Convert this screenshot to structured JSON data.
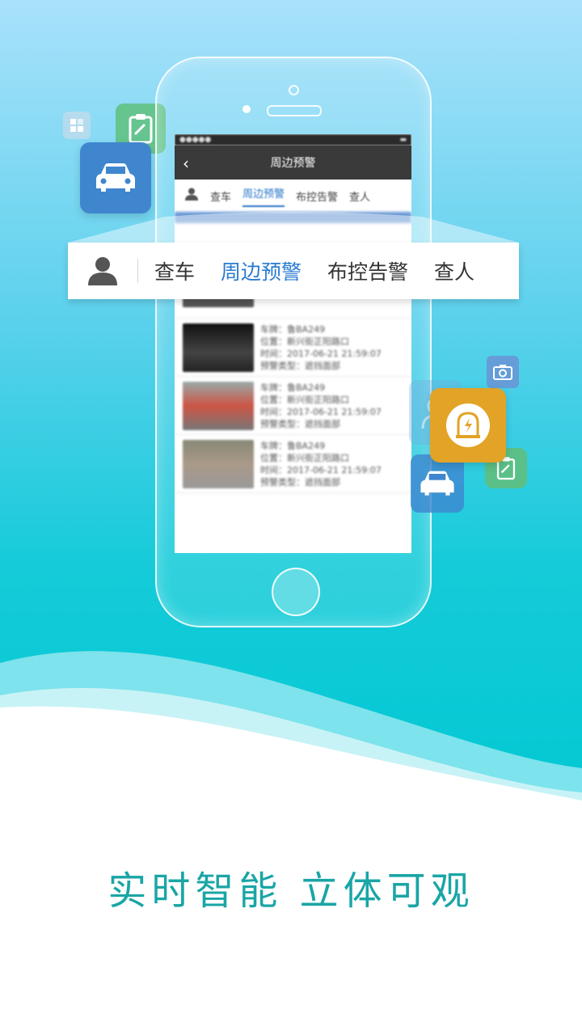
{
  "slogan": "实时智能 立体可观",
  "overlay_tabs": {
    "items": [
      "查车",
      "周边预警",
      "布控告警",
      "查人"
    ],
    "active": "周边预警"
  },
  "screen": {
    "title": "周边预警",
    "small_tabs": [
      "查车",
      "周边预警",
      "布控告警",
      "查人"
    ],
    "records": [
      {
        "plate": "车牌：鲁BA249",
        "location": "位置：新兴街正阳路口",
        "time": "时间：2017-06-21  21:59:07",
        "type": "预警类型：遮挡面部"
      },
      {
        "plate": "车牌：鲁BA249",
        "location": "位置：新兴街正阳路口",
        "time": "时间：2017-06-21  21:59:07",
        "type": "预警类型：遮挡面部"
      },
      {
        "plate": "车牌：鲁BA249",
        "location": "位置：新兴街正阳路口",
        "time": "时间：2017-06-21  21:59:07",
        "type": "预警类型：遮挡面部"
      }
    ]
  },
  "colors": {
    "accent": "#2b7bd0",
    "slogan": "#1aa5a6",
    "car_tile": "#3f86cf",
    "alarm_tile": "#e2a326",
    "clipboard_tile": "#5fbf7d"
  },
  "icons": [
    "user-icon",
    "car-icon",
    "clipboard-icon",
    "camera-icon",
    "alarm-icon",
    "grid-icon",
    "back-chevron-icon",
    "home-button"
  ]
}
